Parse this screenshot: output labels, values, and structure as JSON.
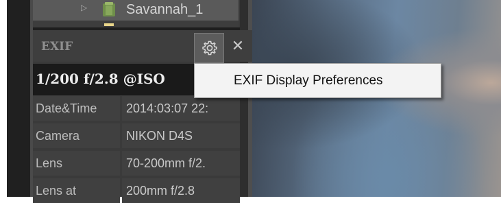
{
  "folder_tree": {
    "expand_icon": "triangle-right-icon",
    "folder_icon": "folder-icon",
    "label": "Savannah_1"
  },
  "exif_panel": {
    "title": "EXIF",
    "settings_icon": "gear-icon",
    "close_icon": "close-icon",
    "close_glyph": "✕",
    "summary": "1/200 f/2.8 @ISO",
    "rows": [
      {
        "key": "Date&Time",
        "value": "2014:03:07 22:"
      },
      {
        "key": "Camera",
        "value": "NIKON D4S"
      },
      {
        "key": "Lens",
        "value": "70-200mm f/2."
      },
      {
        "key": "Lens at",
        "value": "200mm f/2.8"
      }
    ]
  },
  "context_menu": {
    "items": [
      {
        "label": "EXIF Display Preferences"
      }
    ]
  }
}
